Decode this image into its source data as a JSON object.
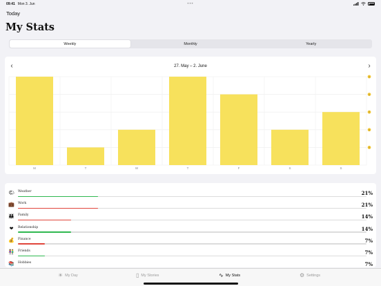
{
  "status": {
    "time": "09:41",
    "date": "Mon 3. Jun",
    "dots": "•••"
  },
  "back_label": "Today",
  "title": "My Stats",
  "segments": [
    {
      "label": "Weekly",
      "active": true
    },
    {
      "label": "Monthly",
      "active": false
    },
    {
      "label": "Yearly",
      "active": false
    }
  ],
  "chart_header": {
    "prev": "‹",
    "next": "›",
    "range": "27. May – 2. June"
  },
  "chart_data": {
    "type": "bar",
    "categories": [
      "M",
      "T",
      "W",
      "T",
      "F",
      "S",
      "S"
    ],
    "values": [
      5,
      1,
      2,
      5,
      4,
      2,
      3
    ],
    "ylim": [
      0,
      5
    ],
    "mood_levels": [
      5,
      4,
      3,
      2,
      1
    ],
    "bar_color": "#f7e15c",
    "grid": true
  },
  "categories": [
    {
      "name": "Weather",
      "icon": "🌤",
      "icon_name": "weather-icon",
      "pct_label": "21%",
      "fraction": 0.21,
      "color": "#2eb84f"
    },
    {
      "name": "Work",
      "icon": "💼",
      "icon_name": "work-icon",
      "pct_label": "21%",
      "fraction": 0.21,
      "color": "#e0453a"
    },
    {
      "name": "Family",
      "icon": "👪",
      "icon_name": "family-icon",
      "pct_label": "14%",
      "fraction": 0.14,
      "color": "#e0453a"
    },
    {
      "name": "Relationship",
      "icon": "❤",
      "icon_name": "heart-icon",
      "pct_label": "14%",
      "fraction": 0.14,
      "color": "#2eb84f"
    },
    {
      "name": "Finance",
      "icon": "💰",
      "icon_name": "money-bag-icon",
      "pct_label": "7%",
      "fraction": 0.07,
      "color": "#e0453a"
    },
    {
      "name": "Friends",
      "icon": "👫",
      "icon_name": "friends-icon",
      "pct_label": "7%",
      "fraction": 0.07,
      "color": "#2eb84f"
    },
    {
      "name": "Hobbies",
      "icon": "📚",
      "icon_name": "books-icon",
      "pct_label": "7%",
      "fraction": 0.07,
      "color": "#2eb84f"
    }
  ],
  "tabs": [
    {
      "label": "My Day",
      "icon": "☀",
      "icon_name": "sun-icon",
      "active": false
    },
    {
      "label": "My Stories",
      "icon": "▯",
      "icon_name": "book-icon",
      "active": false
    },
    {
      "label": "My Stats",
      "icon": "∿",
      "icon_name": "chart-line-icon",
      "active": true
    },
    {
      "label": "Settings",
      "icon": "⚙",
      "icon_name": "gear-icon",
      "active": false
    }
  ]
}
